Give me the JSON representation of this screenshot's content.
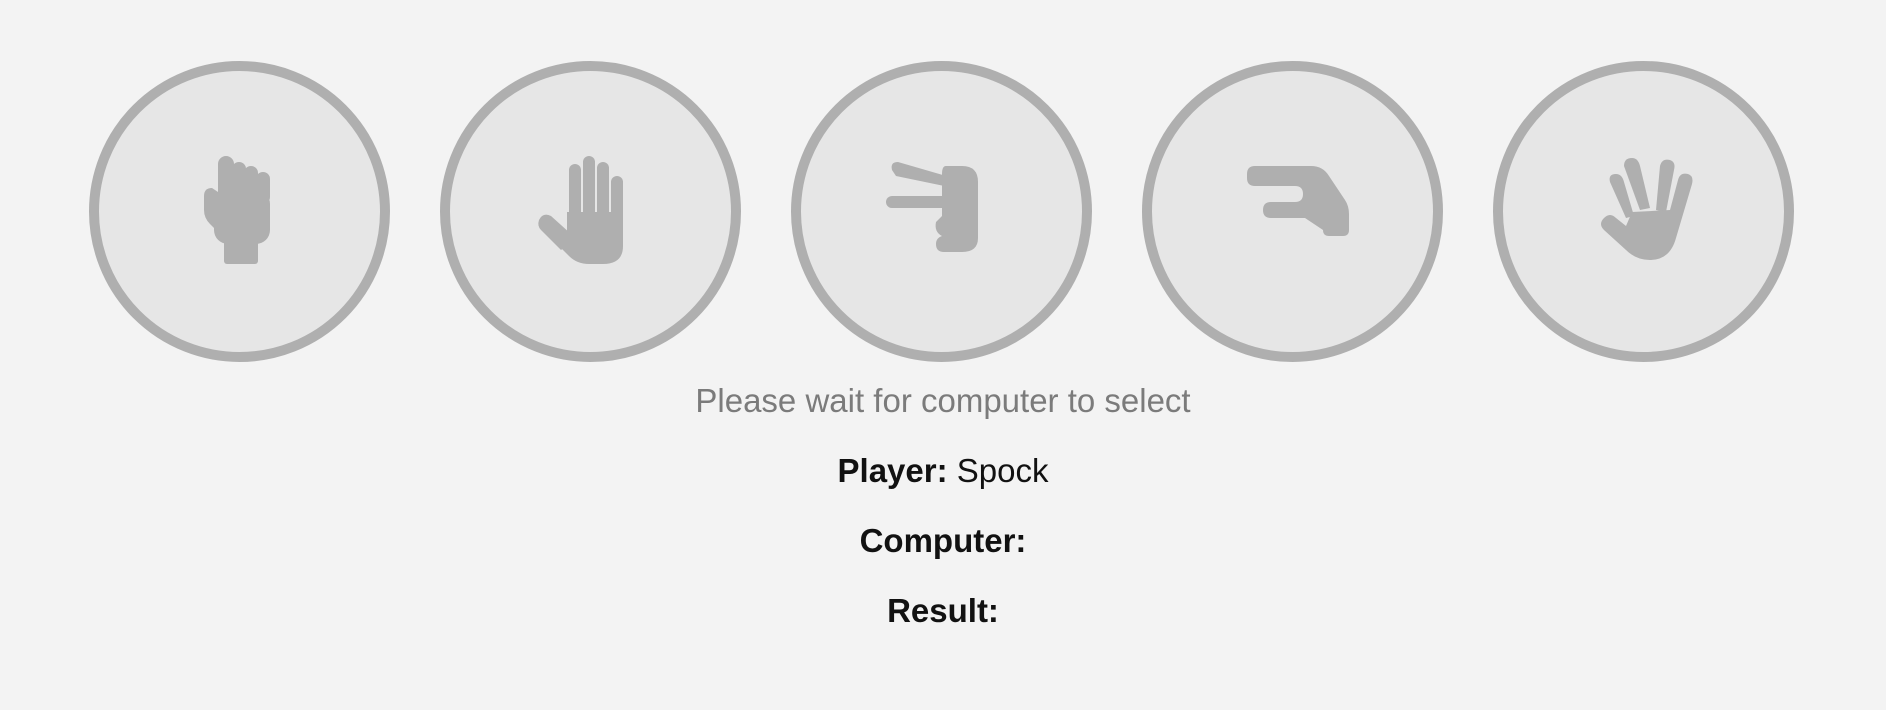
{
  "choices": [
    {
      "id": "rock",
      "icon": "hand-fist-icon"
    },
    {
      "id": "paper",
      "icon": "hand-paper-icon"
    },
    {
      "id": "scissors",
      "icon": "hand-scissors-icon"
    },
    {
      "id": "lizard",
      "icon": "hand-lizard-icon"
    },
    {
      "id": "spock",
      "icon": "hand-spock-icon"
    }
  ],
  "status": "Please wait for computer to select",
  "player": {
    "label": "Player:",
    "value": "Spock"
  },
  "computer": {
    "label": "Computer:",
    "value": ""
  },
  "result": {
    "label": "Result:",
    "value": ""
  },
  "colors": {
    "background": "#f3f3f3",
    "circle_fill": "#e6e6e6",
    "circle_border": "#afafaf",
    "icon": "#afafaf",
    "status_text": "#7b7b7b",
    "label_text": "#111111"
  }
}
